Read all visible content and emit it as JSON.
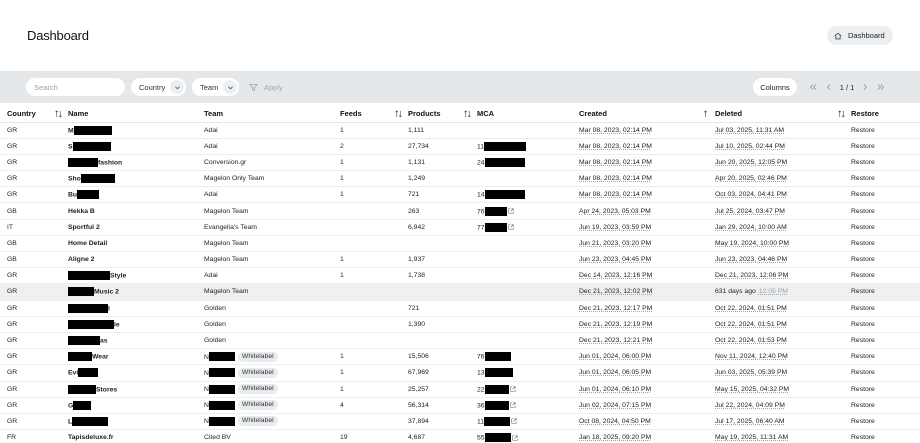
{
  "header": {
    "title": "Dashboard",
    "breadcrumb": "Dashboard"
  },
  "toolbar": {
    "search_placeholder": "Search",
    "country_label": "Country",
    "team_label": "Team",
    "apply_label": "Apply",
    "columns_label": "Columns",
    "page_indicator": "1 / 1"
  },
  "table": {
    "columns": [
      "Country",
      "Name",
      "Team",
      "Feeds",
      "Products",
      "MCA",
      "Created",
      "Deleted",
      "Restore"
    ],
    "rows": [
      {
        "country": "GR",
        "name_prefix": "M",
        "name_suffix": "",
        "redact": 38,
        "team": "Adai",
        "tag": "",
        "feeds": "1",
        "products": "1,111",
        "mca_prefix": "",
        "mca_redact": 0,
        "mca_link": false,
        "created": "Mar 08, 2023, 02:14 PM",
        "deleted": "Jul 03, 2025, 11:31 AM",
        "deleted_grey": "",
        "restore": "Restore"
      },
      {
        "country": "GR",
        "name_prefix": "S",
        "name_suffix": "",
        "redact": 38,
        "team": "Adai",
        "tag": "",
        "feeds": "2",
        "products": "27,734",
        "mca_prefix": "11",
        "mca_redact": 42,
        "mca_link": false,
        "created": "Mar 08, 2023, 02:14 PM",
        "deleted": "Jul 10, 2025, 02:44 PM",
        "deleted_grey": "",
        "restore": "Restore"
      },
      {
        "country": "GR",
        "name_prefix": "",
        "name_suffix": "fashion",
        "redact": 30,
        "team": "Conversion.gr",
        "tag": "",
        "feeds": "1",
        "products": "1,131",
        "mca_prefix": "24",
        "mca_redact": 40,
        "mca_link": false,
        "created": "Mar 08, 2023, 02:14 PM",
        "deleted": "Jun 20, 2025, 12:05 PM",
        "deleted_grey": "",
        "restore": "Restore"
      },
      {
        "country": "GR",
        "name_prefix": "Sho",
        "name_suffix": "",
        "redact": 34,
        "team": "Magelon Only Team",
        "tag": "",
        "feeds": "1",
        "products": "1,249",
        "mca_prefix": "",
        "mca_redact": 0,
        "mca_link": false,
        "created": "Mar 08, 2023, 02:14 PM",
        "deleted": "Apr 20, 2025, 02:46 PM",
        "deleted_grey": "",
        "restore": "Restore"
      },
      {
        "country": "GR",
        "name_prefix": "Bu",
        "name_suffix": "",
        "redact": 22,
        "team": "Adai",
        "tag": "",
        "feeds": "1",
        "products": "721",
        "mca_prefix": "14",
        "mca_redact": 40,
        "mca_link": false,
        "created": "Mar 08, 2023, 02:14 PM",
        "deleted": "Oct 03, 2024, 04:41 PM",
        "deleted_grey": "",
        "restore": "Restore"
      },
      {
        "country": "GB",
        "name_prefix": "Hekka B",
        "name_suffix": "",
        "redact": 0,
        "team": "Magelon Team",
        "tag": "",
        "feeds": "",
        "products": "263",
        "mca_prefix": "76",
        "mca_redact": 22,
        "mca_link": true,
        "created": "Apr 24, 2023, 05:03 PM",
        "deleted": "Jul 25, 2024, 03:47 PM",
        "deleted_grey": "",
        "restore": "Restore"
      },
      {
        "country": "IT",
        "name_prefix": "Sportful 2",
        "name_suffix": "",
        "redact": 0,
        "team": "Evangelia's Team",
        "tag": "",
        "feeds": "",
        "products": "6,942",
        "mca_prefix": "77",
        "mca_redact": 22,
        "mca_link": true,
        "created": "Jun 19, 2023, 03:59 PM",
        "deleted": "Jan 29, 2024, 10:00 AM",
        "deleted_grey": "",
        "restore": "Restore"
      },
      {
        "country": "GB",
        "name_prefix": "Home Detail",
        "name_suffix": "",
        "redact": 0,
        "team": "Magelon Team",
        "tag": "",
        "feeds": "",
        "products": "",
        "mca_prefix": "",
        "mca_redact": 0,
        "mca_link": false,
        "created": "Jun 21, 2023, 03:20 PM",
        "deleted": "May 19, 2024, 10:00 PM",
        "deleted_grey": "",
        "restore": "Restore"
      },
      {
        "country": "GB",
        "name_prefix": "Aligne 2",
        "name_suffix": "",
        "redact": 0,
        "team": "Magelon Team",
        "tag": "",
        "feeds": "1",
        "products": "1,937",
        "mca_prefix": "",
        "mca_redact": 0,
        "mca_link": false,
        "created": "Jun 23, 2023, 04:45 PM",
        "deleted": "Jun 23, 2023, 04:46 PM",
        "deleted_grey": "",
        "restore": "Restore"
      },
      {
        "country": "GR",
        "name_prefix": "",
        "name_suffix": "Style",
        "redact": 42,
        "team": "Adai",
        "tag": "",
        "feeds": "1",
        "products": "1,738",
        "mca_prefix": "",
        "mca_redact": 0,
        "mca_link": false,
        "created": "Dec 14, 2023, 12:16 PM",
        "deleted": "Dec 21, 2023, 12:06 PM",
        "deleted_grey": "",
        "restore": "Restore"
      },
      {
        "country": "GR",
        "name_prefix": "",
        "name_suffix": "Music 2",
        "redact": 26,
        "team": "Magelon Team",
        "tag": "",
        "feeds": "",
        "products": "",
        "mca_prefix": "",
        "mca_redact": 0,
        "mca_link": false,
        "created": "Dec 21, 2023, 12:02 PM",
        "deleted": "631 days ago",
        "deleted_grey": "12:05 PM",
        "restore": "Restore",
        "highlight": true
      },
      {
        "country": "GR",
        "name_prefix": "",
        "name_suffix": "l",
        "redact": 40,
        "team": "Golden",
        "tag": "",
        "feeds": "",
        "products": "721",
        "mca_prefix": "",
        "mca_redact": 0,
        "mca_link": false,
        "created": "Dec 21, 2023, 12:17 PM",
        "deleted": "Oct 22, 2024, 01:51 PM",
        "deleted_grey": "",
        "restore": "Restore"
      },
      {
        "country": "GR",
        "name_prefix": "",
        "name_suffix": "le",
        "redact": 46,
        "team": "Golden",
        "tag": "",
        "feeds": "",
        "products": "1,390",
        "mca_prefix": "",
        "mca_redact": 0,
        "mca_link": false,
        "created": "Dec 21, 2023, 12:19 PM",
        "deleted": "Oct 22, 2024, 01:51 PM",
        "deleted_grey": "",
        "restore": "Restore"
      },
      {
        "country": "GR",
        "name_prefix": "",
        "name_suffix": "as",
        "redact": 32,
        "team": "Golden",
        "tag": "",
        "feeds": "",
        "products": "",
        "mca_prefix": "",
        "mca_redact": 0,
        "mca_link": false,
        "created": "Dec 21, 2023, 12:21 PM",
        "deleted": "Oct 22, 2024, 01:53 PM",
        "deleted_grey": "",
        "restore": "Restore"
      },
      {
        "country": "GR",
        "name_prefix": "",
        "name_suffix": "Wear",
        "redact": 24,
        "team": "N",
        "tag": "Whitelabel",
        "feeds": "1",
        "products": "15,506",
        "mca_prefix": "76",
        "mca_redact": 26,
        "mca_link": false,
        "created": "Jun 01, 2024, 06:00 PM",
        "deleted": "Nov 11, 2024, 12:40 PM",
        "deleted_grey": "",
        "restore": "Restore"
      },
      {
        "country": "GR",
        "name_prefix": "Evi",
        "name_suffix": "",
        "redact": 20,
        "team": "N",
        "tag": "Whitelabel",
        "feeds": "1",
        "products": "67,969",
        "mca_prefix": "13",
        "mca_redact": 28,
        "mca_link": false,
        "created": "Jun 01, 2024, 06:05 PM",
        "deleted": "Jun 03, 2025, 05:39 PM",
        "deleted_grey": "",
        "restore": "Restore"
      },
      {
        "country": "GR",
        "name_prefix": "",
        "name_suffix": "Stores",
        "redact": 28,
        "team": "N",
        "tag": "Whitelabel",
        "feeds": "1",
        "products": "25,257",
        "mca_prefix": "22",
        "mca_redact": 24,
        "mca_link": true,
        "created": "Jun 01, 2024, 06:10 PM",
        "deleted": "May 15, 2025, 04:32 PM",
        "deleted_grey": "",
        "restore": "Restore"
      },
      {
        "country": "GR",
        "name_prefix": "G",
        "name_suffix": "",
        "redact": 18,
        "team": "N",
        "tag": "Whitelabel",
        "feeds": "4",
        "products": "56,314",
        "mca_prefix": "36",
        "mca_redact": 24,
        "mca_link": true,
        "created": "Jun 02, 2024, 07:15 PM",
        "deleted": "Jul 22, 2024, 04:09 PM",
        "deleted_grey": "",
        "restore": "Restore"
      },
      {
        "country": "GR",
        "name_prefix": "L",
        "name_suffix": "",
        "redact": 36,
        "team": "N",
        "tag": "Whitelabel",
        "feeds": "",
        "products": "37,894",
        "mca_prefix": "11",
        "mca_redact": 26,
        "mca_link": true,
        "created": "Oct 08, 2024, 04:50 PM",
        "deleted": "Jul 17, 2025, 06:40 AM",
        "deleted_grey": "",
        "restore": "Restore"
      },
      {
        "country": "FR",
        "name_prefix": "Tapisdeluxe.fr",
        "name_suffix": "",
        "redact": 0,
        "team": "Cited BV",
        "tag": "",
        "feeds": "19",
        "products": "4,687",
        "mca_prefix": "55",
        "mca_redact": 26,
        "mca_link": true,
        "created": "Jan 18, 2025, 09:20 PM",
        "deleted": "May 19, 2025, 11:31 AM",
        "deleted_grey": "",
        "restore": "Restore"
      }
    ]
  }
}
